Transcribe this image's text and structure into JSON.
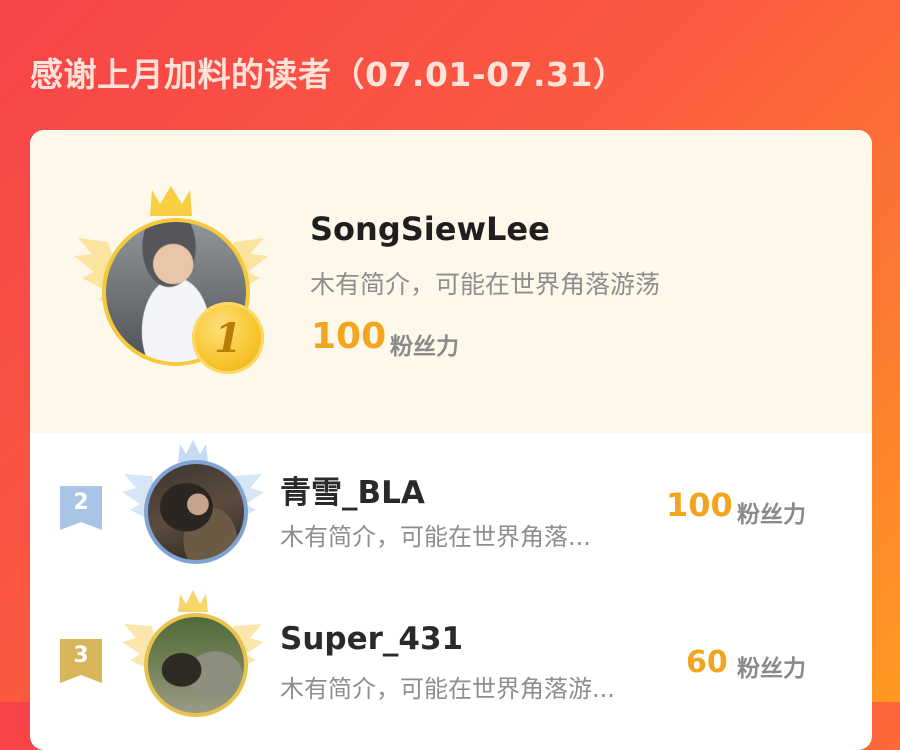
{
  "header": {
    "title": "感谢上月加料的读者（07.01-07.31）"
  },
  "colors": {
    "background_start": "#f7434a",
    "background_end": "#ff9a22",
    "fans_value": "#f2a51f",
    "gold": "#f7c52e",
    "silver": "#9dbde0"
  },
  "ranking": {
    "first": {
      "rank": "1",
      "name": "SongSiewLee",
      "bio": "木有简介，可能在世界角落游荡",
      "fans_value": "100",
      "fans_unit": "粉丝力",
      "rank_badge_icon": "gold-medal-icon",
      "frame_icon": "gold-crown-wings-icon"
    },
    "others": [
      {
        "rank": "2",
        "name": "青雪_BLA",
        "bio": "木有简介，可能在世界角落...",
        "fans_value": "100",
        "fans_unit": "粉丝力",
        "rank_badge_icon": "silver-ribbon-icon",
        "frame_icon": "silver-crown-wings-icon"
      },
      {
        "rank": "3",
        "name": "Super_431",
        "bio": "木有简介，可能在世界角落游...",
        "fans_value": "60",
        "fans_unit": "粉丝力",
        "rank_badge_icon": "bronze-ribbon-icon",
        "frame_icon": "gold-crown-wings-icon"
      }
    ]
  }
}
